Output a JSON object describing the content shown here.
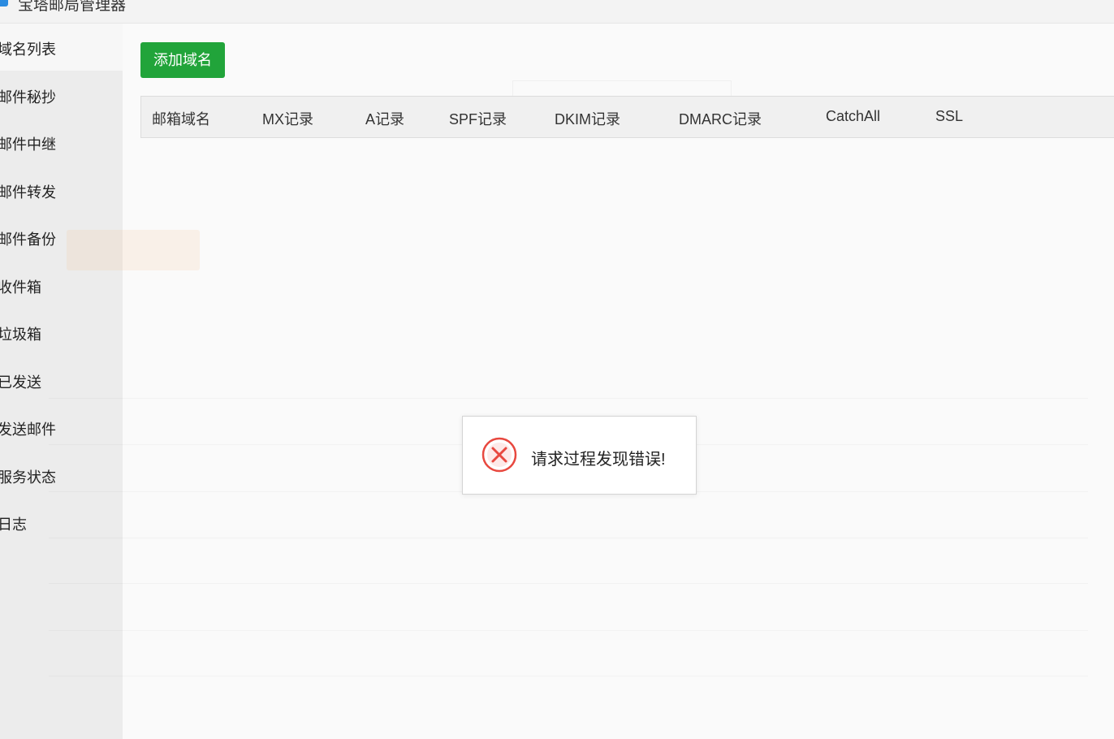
{
  "window": {
    "title": "宝塔邮局管理器"
  },
  "sidebar": {
    "items": [
      {
        "label": "域名列表"
      },
      {
        "label": "邮件秘抄"
      },
      {
        "label": "邮件中继"
      },
      {
        "label": "邮件转发"
      },
      {
        "label": "邮件备份"
      },
      {
        "label": "收件箱"
      },
      {
        "label": "垃圾箱"
      },
      {
        "label": "已发送"
      },
      {
        "label": "发送邮件"
      },
      {
        "label": "服务状态"
      },
      {
        "label": "日志"
      }
    ]
  },
  "toolbar": {
    "add_domain_label": "添加域名"
  },
  "table": {
    "headers": [
      "邮箱域名",
      "MX记录",
      "A记录",
      "SPF记录",
      "DKIM记录",
      "DMARC记录",
      "CatchAll",
      "SSL"
    ]
  },
  "dialog": {
    "icon": "error-circle-icon",
    "message": "请求过程发现错误!"
  },
  "colors": {
    "primary_button": "#21a43a",
    "error_icon": "#e8483f"
  }
}
